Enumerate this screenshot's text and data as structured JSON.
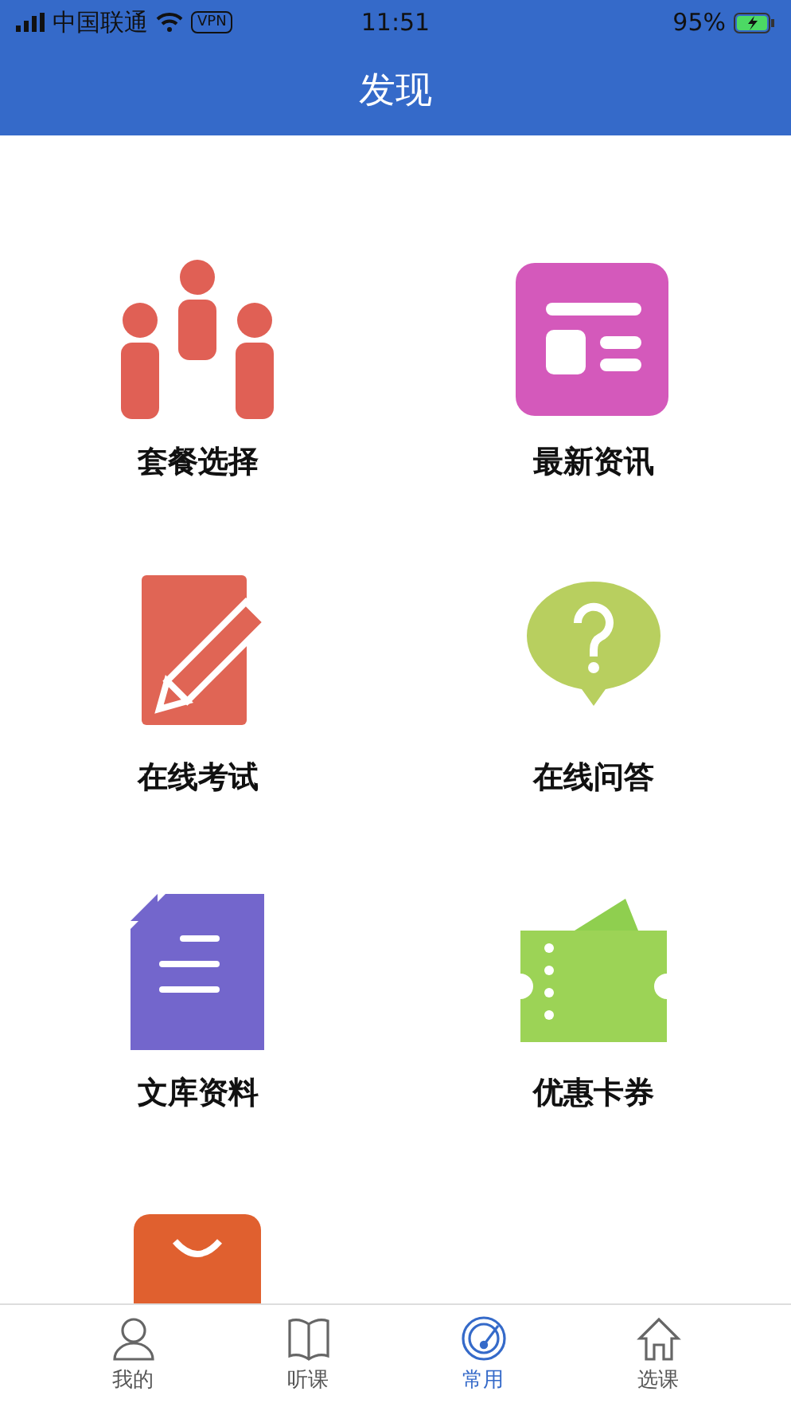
{
  "status_bar": {
    "carrier": "中国联通",
    "vpn": "VPN",
    "time": "11:51",
    "battery": "95%"
  },
  "header": {
    "title": "发现"
  },
  "items": [
    {
      "kind": "people",
      "label": "套餐选择"
    },
    {
      "kind": "news",
      "label": "最新资讯"
    },
    {
      "kind": "exam",
      "label": "在线考试"
    },
    {
      "kind": "question",
      "label": "在线问答"
    },
    {
      "kind": "document",
      "label": "文库资料"
    },
    {
      "kind": "ticket",
      "label": "优惠卡券"
    },
    {
      "kind": "bag"
    }
  ],
  "tabs": [
    {
      "kind": "person",
      "label": "我的",
      "selected": false
    },
    {
      "kind": "book",
      "label": "听课",
      "selected": false
    },
    {
      "kind": "radar",
      "label": "常用",
      "selected": true
    },
    {
      "kind": "home",
      "label": "选课",
      "selected": false
    }
  ]
}
